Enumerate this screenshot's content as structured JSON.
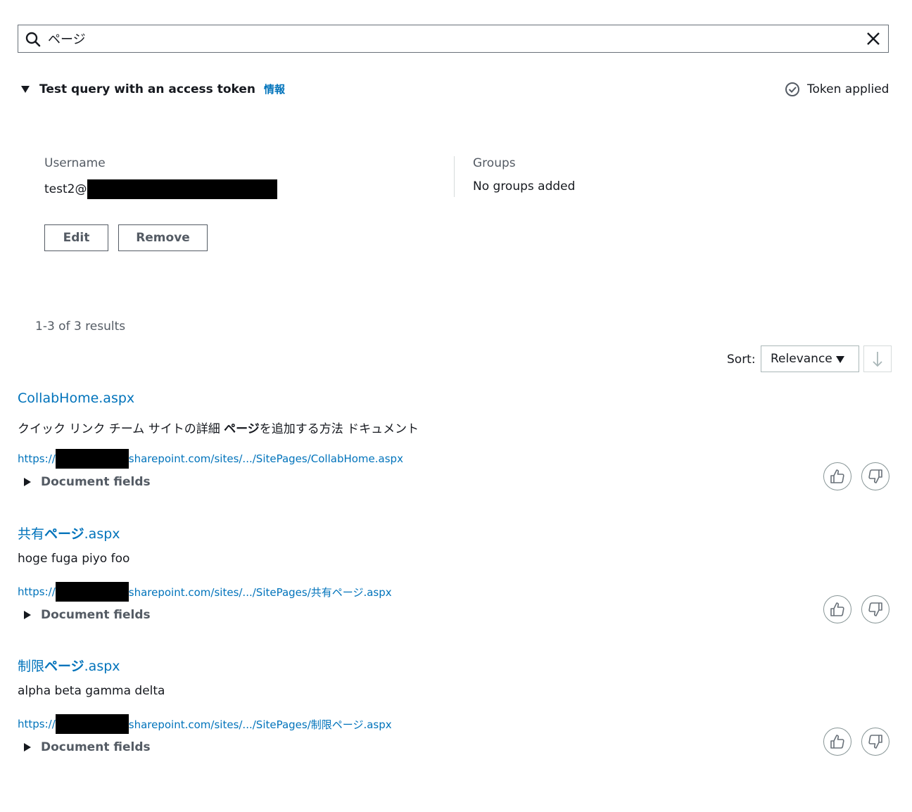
{
  "search": {
    "value": "ページ",
    "placeholder": ""
  },
  "token": {
    "expander_label": "Test query with an access token",
    "info_link": "情報",
    "status": "Token applied",
    "username_label": "Username",
    "username_value": "test2@",
    "groups_label": "Groups",
    "groups_value": "No groups added",
    "edit_label": "Edit",
    "remove_label": "Remove"
  },
  "results_count": "1-3 of 3 results",
  "sort": {
    "label": "Sort:",
    "value": "Relevance"
  },
  "results": [
    {
      "title_pre": "CollabHome.aspx",
      "title_hl": "",
      "title_post": "",
      "excerpt_pre": "クイック リンク チーム サイトの詳細 ",
      "excerpt_hl": "ページ",
      "excerpt_post": "を追加する方法 ドキュメント",
      "url_prefix": "https://",
      "url_suffix": "sharepoint.com/sites/.../SitePages/CollabHome.aspx",
      "fields_label": "Document fields"
    },
    {
      "title_pre": "共有",
      "title_hl": "ページ",
      "title_post": ".aspx",
      "excerpt_pre": "hoge fuga piyo foo",
      "excerpt_hl": "",
      "excerpt_post": "",
      "url_prefix": "https://",
      "url_suffix": "sharepoint.com/sites/.../SitePages/共有ページ.aspx",
      "fields_label": "Document fields"
    },
    {
      "title_pre": "制限",
      "title_hl": "ページ",
      "title_post": ".aspx",
      "excerpt_pre": "alpha beta gamma delta",
      "excerpt_hl": "",
      "excerpt_post": "",
      "url_prefix": "https://",
      "url_suffix": "sharepoint.com/sites/.../SitePages/制限ページ.aspx",
      "fields_label": "Document fields"
    }
  ],
  "icons": {
    "search": "search-icon",
    "clear": "close-icon",
    "status": "check-circle-icon",
    "sort_direction": "arrow-down-icon",
    "thumbs_up": "thumbs-up-icon",
    "thumbs_down": "thumbs-down-icon"
  },
  "colors": {
    "link": "#0073bb",
    "text": "#16191f",
    "muted": "#545b64",
    "border": "#687078"
  }
}
